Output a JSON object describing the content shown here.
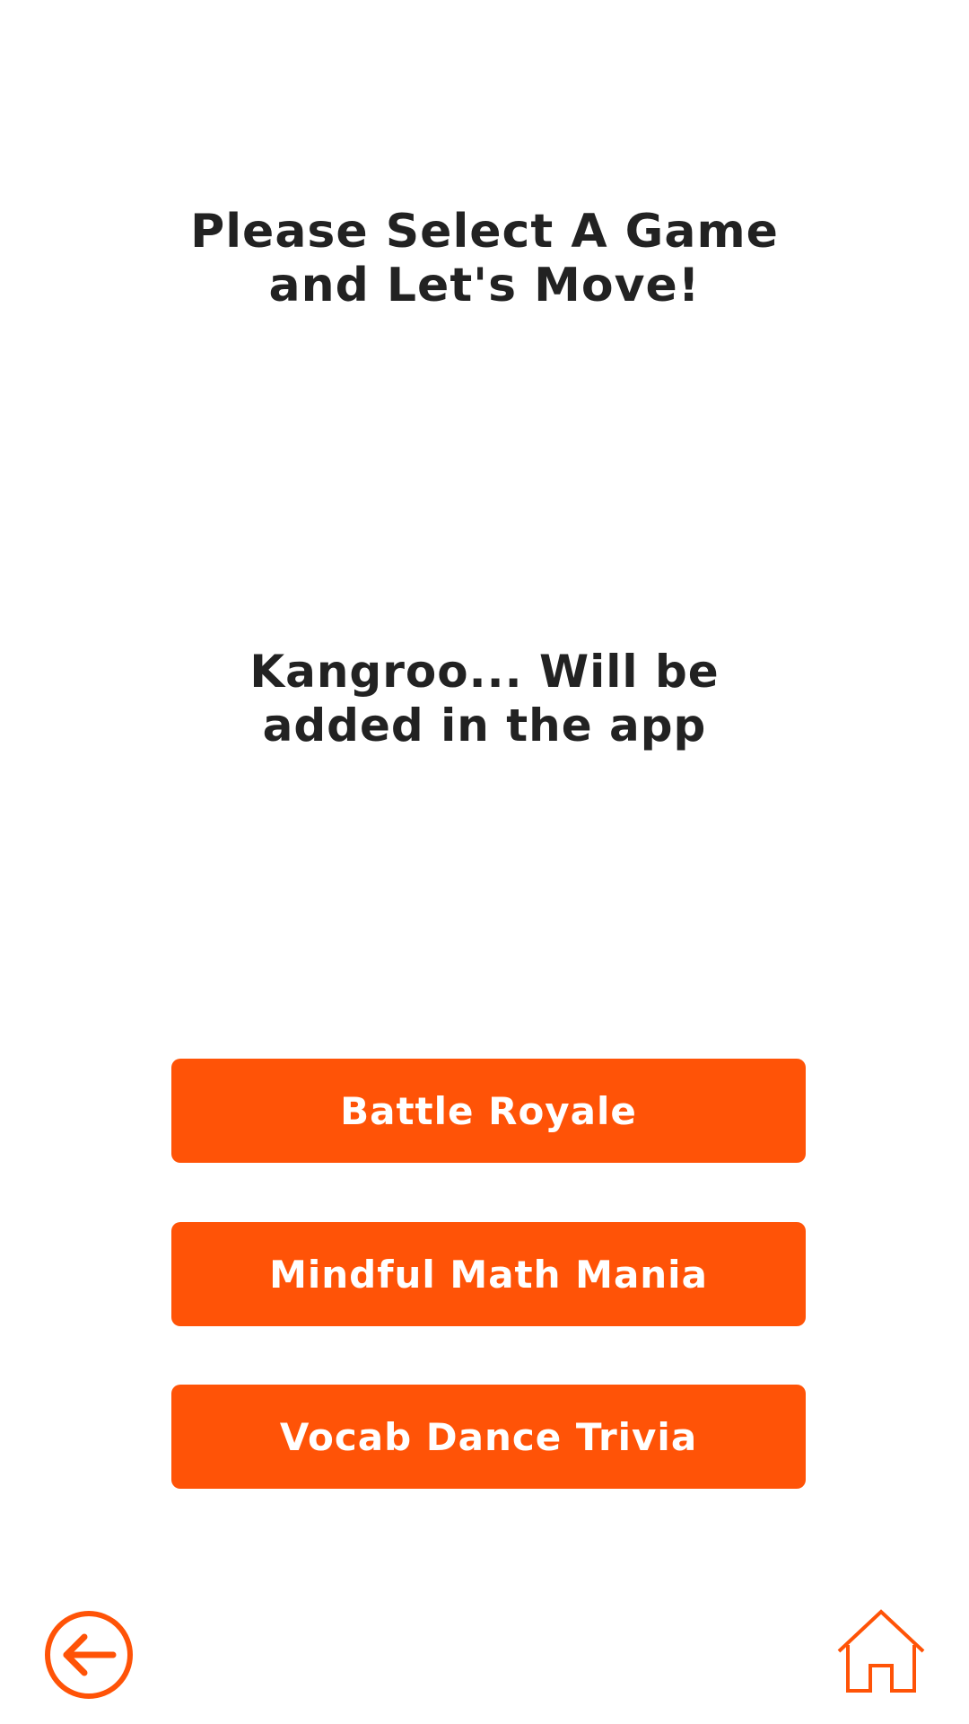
{
  "header": {
    "line1": "Please Select A Game",
    "line2": "and Let's Move!"
  },
  "notice": {
    "line1": "Kangroo... Will be",
    "line2": "added in the app"
  },
  "games": [
    {
      "label": "Battle Royale"
    },
    {
      "label": "Mindful Math Mania"
    },
    {
      "label": "Vocab Dance Trivia"
    }
  ],
  "footer": {
    "back_icon": "back-arrow-circle-icon",
    "home_icon": "home-icon"
  },
  "colors": {
    "accent": "#FF5307",
    "text": "#222222",
    "background": "#FFFFFF"
  }
}
